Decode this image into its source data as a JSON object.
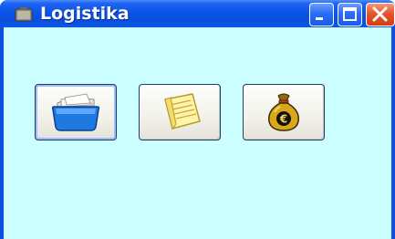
{
  "window": {
    "title": "Logistika",
    "app_icon": "window-app-icon"
  },
  "caption_buttons": [
    "minimize-icon",
    "maximize-icon",
    "close-icon"
  ],
  "toolbar": {
    "buttons": [
      {
        "name": "folder-button",
        "icon": "folder-icon",
        "active": true
      },
      {
        "name": "notepad-button",
        "icon": "notepad-icon",
        "active": false
      },
      {
        "name": "money-bag-button",
        "icon": "money-bag-euro-icon",
        "active": false
      }
    ]
  },
  "colors": {
    "titlebar": "#0b54e6",
    "client_background": "#ccffff",
    "close_button": "#e8542a"
  }
}
